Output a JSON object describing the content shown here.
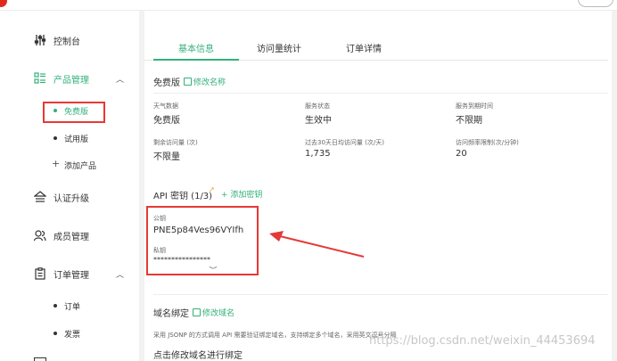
{
  "sidebar": {
    "dashboard": {
      "label": "控制台",
      "icon": "sliders-icon"
    },
    "products": {
      "label": "产品管理",
      "icon": "grid-list-icon",
      "chevron": "︿"
    },
    "product_items": [
      {
        "label": "免费版"
      },
      {
        "label": "试用版"
      },
      {
        "label": "添加产品"
      }
    ],
    "certification": {
      "label": "认证升级",
      "icon": "upgrade-icon"
    },
    "members": {
      "label": "成员管理",
      "icon": "users-icon"
    },
    "orders": {
      "label": "订单管理",
      "icon": "clipboard-icon",
      "chevron": "︿"
    },
    "order_items": [
      {
        "label": "订单"
      },
      {
        "label": "发票"
      }
    ]
  },
  "tabs": [
    {
      "label": "基本信息"
    },
    {
      "label": "访问量统计"
    },
    {
      "label": "订单详情"
    }
  ],
  "plan": {
    "name": "免费版",
    "edit_name_label": "修改名称",
    "fields": [
      {
        "label": "天气数据",
        "value": "免费版"
      },
      {
        "label": "服务状态",
        "value": "生效中"
      },
      {
        "label": "服务到期时间",
        "value": "不限期"
      },
      {
        "label": "剩余访问量 (次)",
        "value": "不限量"
      },
      {
        "label": "过去30天日均访问量 (次/天)",
        "value": "1,735"
      },
      {
        "label": "访问频率限制(次/分钟)",
        "value": "20"
      }
    ]
  },
  "api": {
    "title": "API 密钥 (1/3)",
    "add_key_label": "+ 添加密钥",
    "public_key_label": "公钥",
    "public_key": "PNE5p84Ves96VYIfh",
    "private_key_label": "私钥",
    "private_key": "****************"
  },
  "domain": {
    "title": "域名绑定",
    "edit_label": "修改域名",
    "description": "采用 JSONP 的方式调用 API 需要验证绑定域名，支持绑定多个域名，采用英文逗号分隔",
    "hint": "点击修改域名进行绑定"
  },
  "watermark": "https://blog.csdn.net/weixin_44453694",
  "colors": {
    "accent": "#33b07a",
    "highlight": "#e53935"
  }
}
